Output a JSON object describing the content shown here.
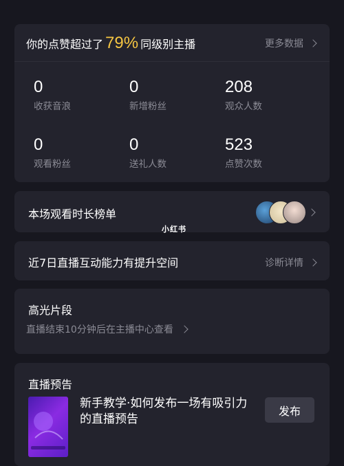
{
  "stats_card": {
    "title_prefix": "你的点赞超过了",
    "percent": "79%",
    "title_suffix": "同级别主播",
    "more_label": "更多数据",
    "items": [
      {
        "value": "0",
        "label": "收获音浪"
      },
      {
        "value": "0",
        "label": "新增粉丝"
      },
      {
        "value": "208",
        "label": "观众人数"
      },
      {
        "value": "0",
        "label": "观看粉丝"
      },
      {
        "value": "0",
        "label": "送礼人数"
      },
      {
        "value": "523",
        "label": "点赞次数"
      }
    ]
  },
  "ranking": {
    "title": "本场观看时长榜单"
  },
  "improve": {
    "title": "近7日直播互动能力有提升空间",
    "action": "诊断详情"
  },
  "highlight": {
    "title": "高光片段",
    "subtitle": "直播结束10分钟后在主播中心查看"
  },
  "preview": {
    "section_title": "直播预告",
    "tutorial_title": "新手教学·如何发布一场有吸引力的直播预告",
    "publish_label": "发布"
  },
  "watermark": "小红书"
}
